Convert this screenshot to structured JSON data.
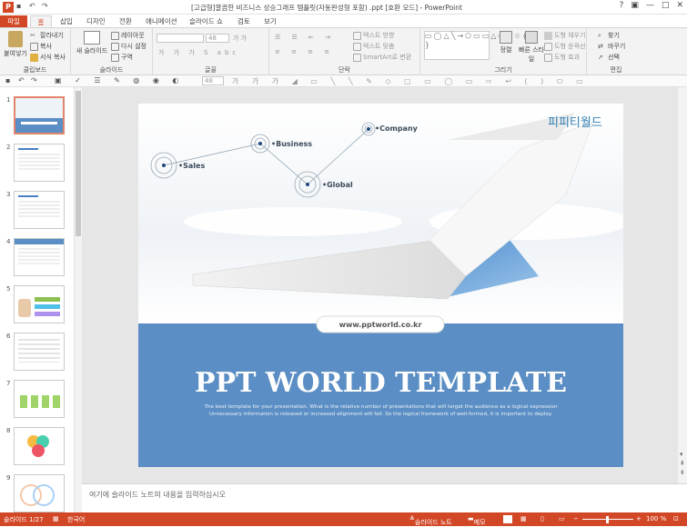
{
  "window": {
    "title": "[고급형]깔끔한 비즈니스 상승그래프 템플릿(자동완성형 포함) .ppt [호환 모드] - PowerPoint",
    "app_letter": "P",
    "controls": [
      "?",
      "▣",
      "—",
      "□",
      "✕"
    ]
  },
  "tabs": [
    "파일",
    "홈",
    "삽입",
    "디자인",
    "전환",
    "애니메이션",
    "슬라이드 쇼",
    "검토",
    "보기"
  ],
  "ribbon": {
    "clipboard": {
      "paste": "붙여넣기",
      "cut": "잘라내기",
      "copy": "복사",
      "format_painter": "서식 복사",
      "label": "클립보드"
    },
    "slides": {
      "new_slide": "새 슬라이드",
      "layout": "레이아웃",
      "reset": "다시 설정",
      "section": "구역",
      "label": "슬라이드"
    },
    "font": {
      "size": "48",
      "label": "글꼴"
    },
    "paragraph": {
      "text_direction": "텍스트 방향",
      "align_text": "텍스트 맞춤",
      "smartart": "SmartArt로 변환",
      "label": "단락"
    },
    "drawing": {
      "arrange": "정렬",
      "quick_styles": "빠른 스타일",
      "fill": "도형 채우기",
      "outline": "도형 윤곽선",
      "effects": "도형 효과",
      "label": "그리기"
    },
    "editing": {
      "find": "찾기",
      "replace": "바꾸기",
      "select": "선택",
      "label": "편집"
    }
  },
  "toolbar2": {
    "font_size": "48"
  },
  "thumbnails": [
    {
      "num": "1"
    },
    {
      "num": "2"
    },
    {
      "num": "3"
    },
    {
      "num": "4"
    },
    {
      "num": "5"
    },
    {
      "num": "6"
    },
    {
      "num": "7"
    },
    {
      "num": "8"
    },
    {
      "num": "9"
    }
  ],
  "slide": {
    "brand": "피피티월드",
    "url": "www.pptworld.co.kr",
    "title": "PPT WORLD TEMPLATE",
    "subtitle_1": "The best template for your presentation. What is the relative number of presentations that will target the audience as a logical expression",
    "subtitle_2": "Unnecessary information is released or increased alignment will fail. So the logical framework of well-formed, it is important to deploy.",
    "nodes": {
      "sales": "•Sales",
      "business": "•Business",
      "global": "•Global",
      "company": "•Company"
    },
    "colors": {
      "band": "#5b8ec4",
      "brand": "#2f7fb0",
      "accent": "#d24726"
    }
  },
  "notes": {
    "placeholder": "여기에 슬라이드 노트의 내용을 입력하십시오"
  },
  "status": {
    "slide_count": "슬라이드 1/27",
    "language": "한국어",
    "notes": "슬라이드 노트",
    "comments": "메모",
    "zoom": "100 %"
  }
}
